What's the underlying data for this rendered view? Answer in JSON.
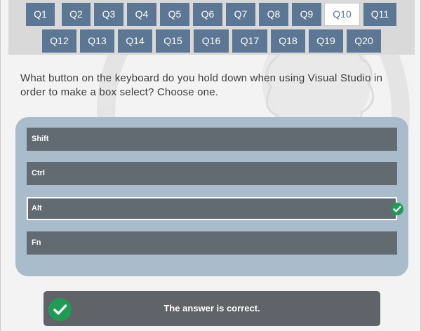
{
  "nav": {
    "row1": [
      "Q1",
      "Q2",
      "Q3",
      "Q4",
      "Q5",
      "Q6",
      "Q7",
      "Q8",
      "Q9",
      "Q10",
      "Q11"
    ],
    "row2": [
      "Q12",
      "Q13",
      "Q14",
      "Q15",
      "Q16",
      "Q17",
      "Q18",
      "Q19",
      "Q20"
    ],
    "active": "Q10"
  },
  "question": {
    "text": "What button on the keyboard do you hold down when using Visual Studio in order to make a box select? Choose one."
  },
  "answers": {
    "options": [
      "Shift",
      "Ctrl",
      "Alt",
      "Fn"
    ],
    "selected": "Alt"
  },
  "result": {
    "message": "The answer is correct."
  },
  "colors": {
    "nav_button": "#5b7794",
    "option": "#626a72",
    "answers_panel": "#a9bccc",
    "correct_green": "#1f9b55"
  },
  "icons": {
    "answer_check": "check-circle-icon",
    "result_check": "check-circle-icon"
  }
}
